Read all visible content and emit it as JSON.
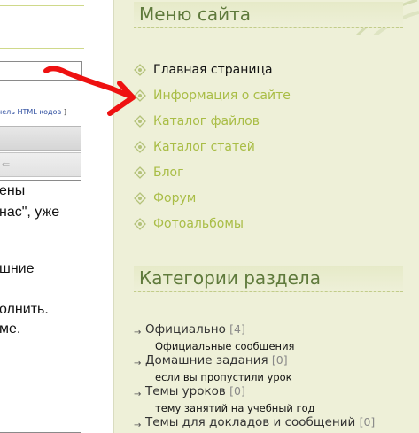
{
  "left": {
    "html_link_prefix": "нель HTML кодов",
    "html_link_suffix": " ]",
    "toolbar_arrow": "⇐",
    "textarea_lines": [
      "ены",
      "нас\", уже",
      "",
      "шние",
      "",
      "олнить.",
      "ме."
    ]
  },
  "sidebar": {
    "menu_title": "Меню сайта",
    "menu_items": [
      {
        "label": "Главная страница",
        "active": true
      },
      {
        "label": "Информация о сайте",
        "active": false
      },
      {
        "label": "Каталог файлов",
        "active": false
      },
      {
        "label": "Каталог статей",
        "active": false
      },
      {
        "label": "Блог",
        "active": false
      },
      {
        "label": "Форум",
        "active": false
      },
      {
        "label": "Фотоальбомы",
        "active": false
      }
    ],
    "categories_title": "Категории раздела",
    "categories": [
      {
        "name": "Официально",
        "count": "[4]",
        "desc": "Официальные сообщения"
      },
      {
        "name": "Домашние задания",
        "count": "[0]",
        "desc": "если вы пропустили урок"
      },
      {
        "name": "Темы уроков",
        "count": "[0]",
        "desc": "тему занятий на учебный год"
      },
      {
        "name": "Темы для докладов и сообщений",
        "count": "[0]",
        "desc": ""
      }
    ]
  },
  "colors": {
    "link": "#a9bd46",
    "title": "#5f7a3c",
    "annotation": "#ee1111"
  }
}
